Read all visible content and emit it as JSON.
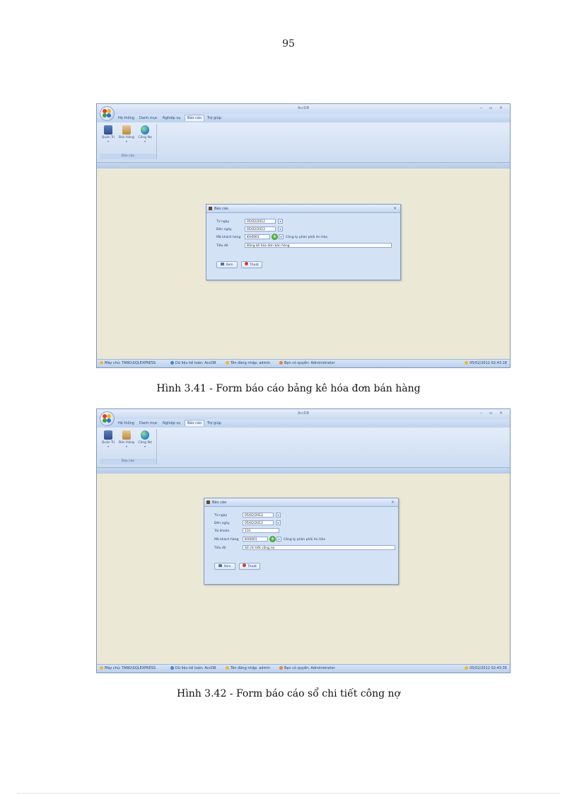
{
  "page": {
    "number": "95"
  },
  "figures": [
    {
      "caption": "Hình 3.41 - Form báo cáo bảng kê hóa đơn bán hàng",
      "window": {
        "title": "AccDB",
        "menu": [
          "Hệ thống",
          "Danh mục",
          "Nghiệp vụ",
          "Báo cáo",
          "Trợ giúp"
        ],
        "ribbon": {
          "buttons": [
            "Quản Trị",
            "Bán Hàng",
            "Công Nợ"
          ],
          "group_label": "Báo cáo"
        },
        "status": {
          "server": "Máy chủ: TANG\\SQLEXPRESS",
          "database": "Dữ liệu kế toán: AccDB",
          "user": "Tên đăng nhập: admin",
          "role": "Bạn có quyền: Administrator",
          "datetime": "05/02/2012 02:43:18"
        },
        "dialog": {
          "title": "Báo cáo",
          "from_date_label": "Từ ngày",
          "from_date": "05/02/2012",
          "to_date_label": "Đến ngày",
          "to_date": "05/02/2012",
          "customer_code_label": "Mã khách hàng",
          "customer_code": "KH0001",
          "company": "Công ty phân phối An Hòa",
          "report_title_label": "Tiêu đề",
          "report_title": "Bảng kê hóa đơn bán hàng",
          "print_button": "Xem",
          "exit_button": "Thoát"
        }
      }
    },
    {
      "caption": "Hình 3.42 - Form báo cáo sổ chi tiết công nợ",
      "window": {
        "title": "AccDB",
        "menu": [
          "Hệ thống",
          "Danh mục",
          "Nghiệp vụ",
          "Báo cáo",
          "Trợ giúp"
        ],
        "ribbon": {
          "buttons": [
            "Quản Trị",
            "Bán Hàng",
            "Công Nợ"
          ],
          "group_label": "Báo cáo"
        },
        "status": {
          "server": "Máy chủ: TANG\\SQLEXPRESS",
          "database": "Dữ liệu kế toán: AccDB",
          "user": "Tên đăng nhập: admin",
          "role": "Bạn có quyền: Administrator",
          "datetime": "05/02/2012 02:43:35"
        },
        "dialog": {
          "title": "Báo cáo",
          "from_date_label": "Từ ngày",
          "from_date": "05/02/2012",
          "to_date_label": "Đến ngày",
          "to_date": "05/02/2012",
          "account_label": "Tài khoản",
          "account": "131",
          "customer_code_label": "Mã khách hàng",
          "customer_code": "KH0001",
          "company": "Công ty phân phối An Hòa",
          "report_title_label": "Tiêu đề",
          "report_title": "Sổ chi tiết công nợ",
          "print_button": "Xem",
          "exit_button": "Thoát"
        }
      }
    }
  ]
}
